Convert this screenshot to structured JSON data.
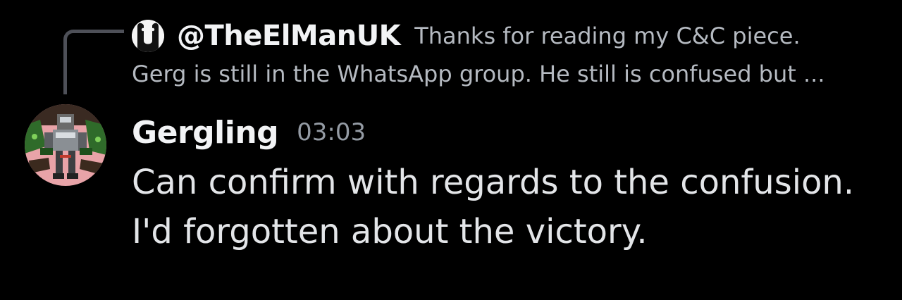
{
  "reply": {
    "author": "@TheElManUK",
    "preview_line1": "Thanks for reading my C&C piece.",
    "preview_line2": "Gerg is still in the WhatsApp group. He still is confused but ..."
  },
  "message": {
    "author": "Gergling",
    "timestamp": "03:03",
    "lines": [
      "Can confirm with regards to the confusion.",
      "I'd forgotten about the victory."
    ]
  },
  "colors": {
    "background": "#000000",
    "author_name": "#f2f3f5",
    "body_text": "#e3e5e8",
    "muted_text": "#b5bac1",
    "timestamp": "#949ba4",
    "reply_spine": "#4e5058",
    "avatar_bg": "#e8a3a8"
  },
  "icons": {
    "reply_avatar": "penguin-avatar-icon",
    "user_avatar": "robot-avatar-icon"
  }
}
